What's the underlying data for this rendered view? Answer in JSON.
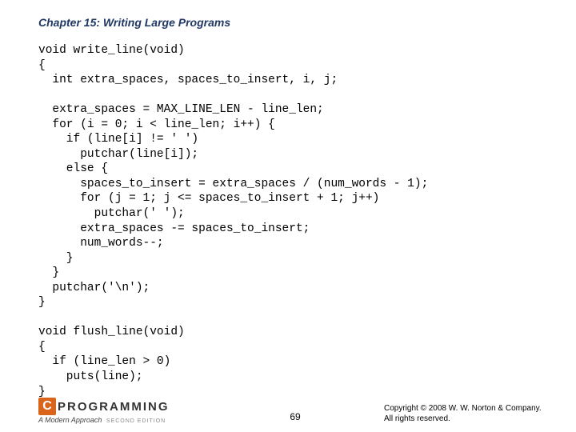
{
  "chapter_title": "Chapter 15: Writing Large Programs",
  "code": "void write_line(void)\n{\n  int extra_spaces, spaces_to_insert, i, j;\n\n  extra_spaces = MAX_LINE_LEN - line_len;\n  for (i = 0; i < line_len; i++) {\n    if (line[i] != ' ')\n      putchar(line[i]);\n    else {\n      spaces_to_insert = extra_spaces / (num_words - 1);\n      for (j = 1; j <= spaces_to_insert + 1; j++)\n        putchar(' ');\n      extra_spaces -= spaces_to_insert;\n      num_words--;\n    }\n  }\n  putchar('\\n');\n}\n\nvoid flush_line(void)\n{\n  if (line_len > 0)\n    puts(line);\n}",
  "logo": {
    "c": "C",
    "text": "PROGRAMMING",
    "subtitle": "A Modern Approach",
    "edition": "SECOND EDITION"
  },
  "page_number": "69",
  "copyright": "Copyright © 2008 W. W. Norton & Company.\nAll rights reserved."
}
